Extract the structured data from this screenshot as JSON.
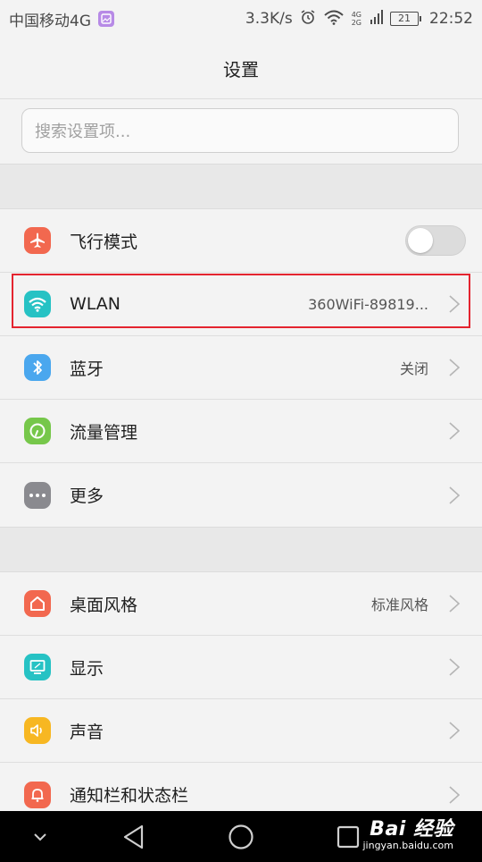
{
  "status_bar": {
    "carrier": "中国移动4G",
    "speed": "3.3K/s",
    "net_top": "4G",
    "net_bottom": "2G",
    "battery": "21",
    "time": "22:52",
    "icons": [
      "gallery-icon",
      "alarm-icon",
      "wifi-signal-icon",
      "cell-signal-icon",
      "battery-icon"
    ]
  },
  "header": {
    "title": "设置"
  },
  "search": {
    "placeholder": "搜索设置项..."
  },
  "group1": {
    "items": [
      {
        "label": "飞行模式",
        "icon": "airplane-icon",
        "color": "#f2684f",
        "control": "toggle",
        "toggle_on": false
      },
      {
        "label": "WLAN",
        "icon": "wifi-icon",
        "color": "#26c2c4",
        "value": "360WiFi-89819..."
      },
      {
        "label": "蓝牙",
        "icon": "bluetooth-icon",
        "color": "#4aa7ee",
        "value": "关闭"
      },
      {
        "label": "流量管理",
        "icon": "data-usage-icon",
        "color": "#76c74a"
      },
      {
        "label": "更多",
        "icon": "more-icon",
        "color": "#8a8a8f"
      }
    ]
  },
  "group2": {
    "items": [
      {
        "label": "桌面风格",
        "icon": "home-icon",
        "color": "#f2684f",
        "value": "标准风格"
      },
      {
        "label": "显示",
        "icon": "display-icon",
        "color": "#26c2c4"
      },
      {
        "label": "声音",
        "icon": "sound-icon",
        "color": "#f7b722"
      },
      {
        "label": "通知栏和状态栏",
        "icon": "notification-icon",
        "color": "#f2684f"
      }
    ]
  },
  "nav_bar": {
    "buttons": [
      "chevron-down-icon",
      "back-icon",
      "home-circle-icon",
      "recents-icon"
    ]
  },
  "watermark": {
    "logo": "Bai 经验",
    "site": "jingyan.baidu.com"
  },
  "highlight_color": "#e4242f"
}
